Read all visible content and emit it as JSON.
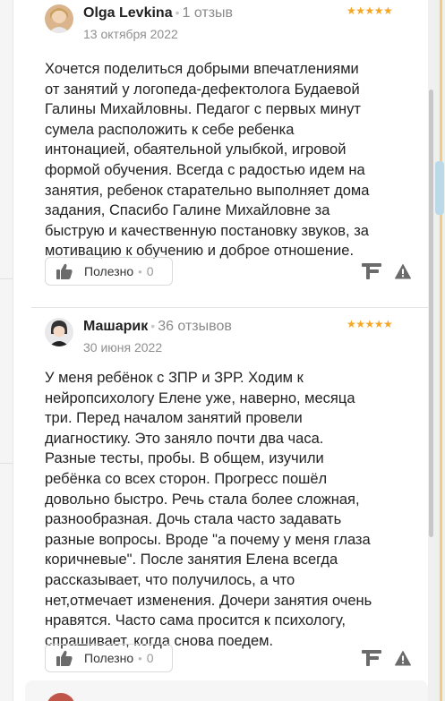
{
  "reviews": [
    {
      "author": "Olga Levkina",
      "review_count": "1 отзыв",
      "date": "13 октября 2022",
      "rating": 5,
      "stars": "★★★★★",
      "text": "Хочется поделиться добрыми впечатлениями\nот занятий у логопеда-дефектолога Будаевой\nГалины Михайловны. Педагог с первых минут\nсумела расположить к себе ребенка\nинтонацией, обаятельной улыбкой, игровой\nформой обучения. Всегда с радостью идем на\nзанятия, ребенок старательно выполняет дома\nзадания, Спасибо Галине Михайловне за\nбыструю и качественную постановку звуков, за\nмотивацию к обучению и доброе отношение.",
      "useful_label": "Полезно",
      "useful_count": "0",
      "sep": "•"
    },
    {
      "author": "Машарик",
      "review_count": "36 отзывов",
      "date": "30 июня 2022",
      "rating": 5,
      "stars": "★★★★★",
      "text": "У меня ребёнок с ЗПР и ЗРР. Ходим к\nнейропсихологу Елене уже, наверно, месяца\nтри. Перед началом занятий провели\nдиагностику. Это заняло почти два часа.\nРазные тесты, пробы. В общем, изучили\nребёнка со всех сторон. Прогресс пошёл\nдовольно быстро. Речь стала более сложная,\nразнообразная. Дочь стала часто задавать\nразные вопросы. Вроде \"а почему у меня глаза\nкоричневые\". После занятия Елена всегда\nрассказывает, что получилось, а что\nнет,отмечает изменения. Дочери занятия очень\nнравятся. Часто сама просится к психологу,\nспрашивает, когда снова поедем.",
      "useful_label": "Полезно",
      "useful_count": "0",
      "sep": "•"
    }
  ],
  "colors": {
    "star": "#f5a623",
    "muted": "#8a8a8a",
    "icon": "#6b6b6b"
  },
  "icons": {
    "useful": "thumbs-up-icon",
    "brand": "brand-f-icon",
    "complain": "warning-icon"
  }
}
